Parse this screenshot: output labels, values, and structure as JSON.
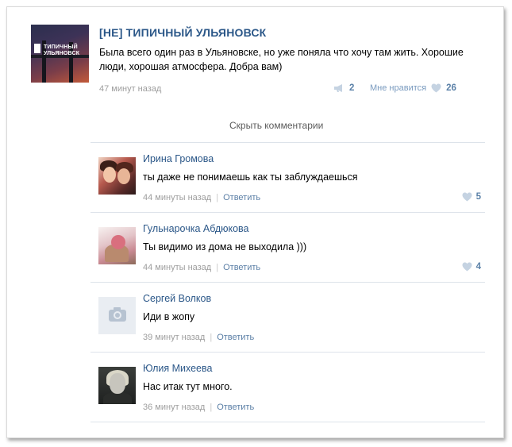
{
  "post": {
    "avatar_text": "ТИПИЧНЫЙ УЛЬЯНОВСК",
    "title": "[НЕ] ТИПИЧНЫЙ УЛЬЯНОВСК",
    "text": "Была всего один раз в Ульяновске, но уже поняла что хочу там жить. Хорошие люди, хорошая атмосфера. Добра вам)",
    "time": "47 минут назад",
    "shares": "2",
    "like_label": "Мне нравится",
    "likes": "26"
  },
  "hide_comments_label": "Скрыть комментарии",
  "comments": [
    {
      "author": "Ирина Громова",
      "text": "ты даже не понимаешь как ты заблуждаешься",
      "time": "44 минуты назад",
      "reply": "Ответить",
      "likes": "5"
    },
    {
      "author": "Гульнарочка Абдюкова",
      "text": "Ты видимо из дома не выходила )))",
      "time": "44 минуты назад",
      "reply": "Ответить",
      "likes": "4"
    },
    {
      "author": "Сергей Волков",
      "text": "Иди в жопу",
      "time": "39 минут назад",
      "reply": "Ответить",
      "likes": ""
    },
    {
      "author": "Юлия Михеева",
      "text": "Нас итак тут много.",
      "time": "36 минут назад",
      "reply": "Ответить",
      "likes": ""
    }
  ],
  "icons": {
    "share": "megaphone-icon",
    "like": "heart-icon",
    "no_photo": "camera-icon"
  },
  "colors": {
    "link": "#2b5788",
    "meta": "#9e9e9e",
    "like_icon": "#c5d3e2",
    "count": "#5b81a8"
  }
}
